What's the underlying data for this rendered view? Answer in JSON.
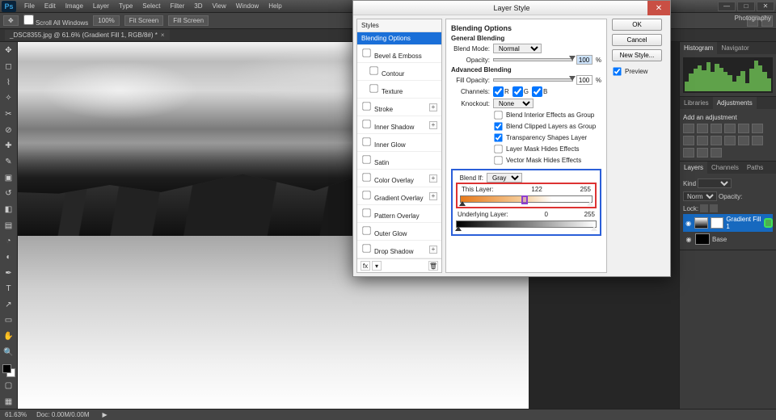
{
  "menubar": {
    "logo": "Ps",
    "items": [
      "File",
      "Edit",
      "Image",
      "Layer",
      "Type",
      "Select",
      "Filter",
      "3D",
      "View",
      "Window",
      "Help"
    ]
  },
  "optbar": {
    "icon": "move-tool",
    "scroll_cb": "Scroll All Windows",
    "zoom": "100%",
    "fit": "Fit Screen",
    "fill": "Fill Screen"
  },
  "workspace": "Photography",
  "doc_tab": "_DSC8355.jpg @ 61.6% (Gradient Fill 1, RGB/8#) *",
  "status": {
    "zoom": "61.63%",
    "doc": "Doc: 0.00M/0.00M"
  },
  "dialog": {
    "title": "Layer Style",
    "left_header": "Styles",
    "left": [
      {
        "label": "Blending Options",
        "sel": true
      },
      {
        "label": "Bevel & Emboss",
        "plus": false,
        "cb": true
      },
      {
        "label": "Contour",
        "cb": true,
        "indent": true
      },
      {
        "label": "Texture",
        "cb": true,
        "indent": true
      },
      {
        "label": "Stroke",
        "plus": true,
        "cb": true
      },
      {
        "label": "Inner Shadow",
        "plus": true,
        "cb": true
      },
      {
        "label": "Inner Glow",
        "cb": true
      },
      {
        "label": "Satin",
        "cb": true
      },
      {
        "label": "Color Overlay",
        "plus": true,
        "cb": true
      },
      {
        "label": "Gradient Overlay",
        "plus": true,
        "cb": true
      },
      {
        "label": "Pattern Overlay",
        "cb": true
      },
      {
        "label": "Outer Glow",
        "cb": true
      },
      {
        "label": "Drop Shadow",
        "plus": true,
        "cb": true
      }
    ],
    "section_title": "Blending Options",
    "general": "General Blending",
    "blend_mode_label": "Blend Mode:",
    "blend_mode": "Normal",
    "opacity_label": "Opacity:",
    "opacity": "100",
    "pct": "%",
    "advanced": "Advanced Blending",
    "fill_label": "Fill Opacity:",
    "fill": "100",
    "channels_label": "Channels:",
    "ch": [
      "R",
      "G",
      "B"
    ],
    "knockout_label": "Knockout:",
    "knockout": "None",
    "adv_checks": [
      {
        "label": "Blend Interior Effects as Group",
        "on": false
      },
      {
        "label": "Blend Clipped Layers as Group",
        "on": true
      },
      {
        "label": "Transparency Shapes Layer",
        "on": true
      },
      {
        "label": "Layer Mask Hides Effects",
        "on": false
      },
      {
        "label": "Vector Mask Hides Effects",
        "on": false
      }
    ],
    "blendif_label": "Blend If:",
    "blendif": "Gray",
    "this_layer": "This Layer:",
    "this_vals": [
      "122",
      "255"
    ],
    "under_layer": "Underlying Layer:",
    "under_vals": [
      "0",
      "255"
    ],
    "buttons": {
      "ok": "OK",
      "cancel": "Cancel",
      "new": "New Style..."
    },
    "preview": "Preview"
  },
  "panels": {
    "hist_tab": "Histogram",
    "nav_tab": "Navigator",
    "lib_tab": "Libraries",
    "adj_tab": "Adjustments",
    "add_adj": "Add an adjustment",
    "layers_tab": "Layers",
    "channels_tab": "Channels",
    "paths_tab": "Paths",
    "kind": "Kind",
    "mode": "Normal",
    "opacity_l": "Opacity:",
    "lock": "Lock:",
    "layer1": "Gradient Fill 1",
    "layer2": "Base"
  }
}
